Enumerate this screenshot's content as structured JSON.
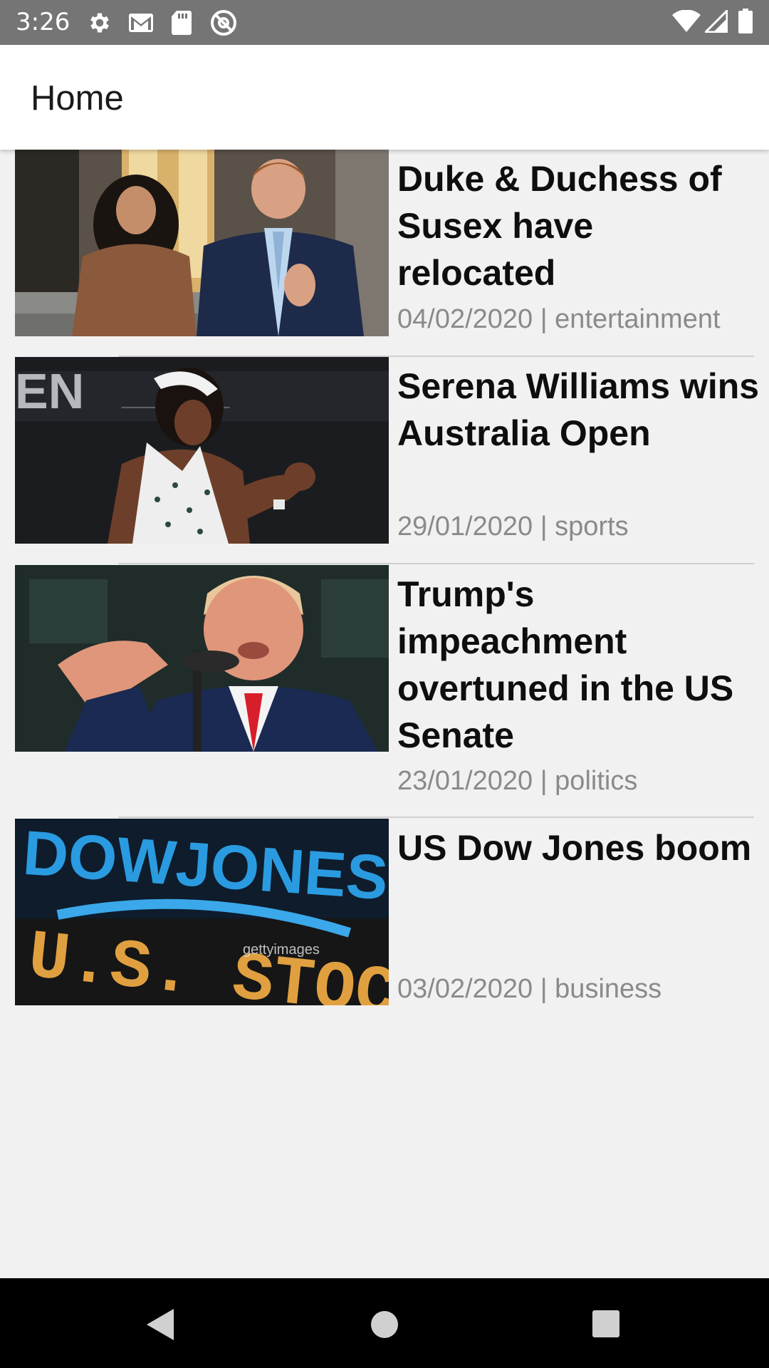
{
  "status_bar": {
    "time": "3:26",
    "left_icons": [
      "settings-gear-icon",
      "gmail-icon",
      "sd-card-icon",
      "at-sign-icon"
    ],
    "right_icons": [
      "wifi-icon",
      "cell-signal-icon",
      "battery-icon"
    ]
  },
  "app_bar": {
    "title": "Home"
  },
  "news": [
    {
      "title": "Duke & Duchess of Susex have relocated",
      "meta": "04/02/2020 | entertainment",
      "image_icon": "royal-couple-photo"
    },
    {
      "title": "Serena Williams wins Australia Open",
      "meta": "29/01/2020 | sports",
      "image_icon": "tennis-player-photo"
    },
    {
      "title": "Trump's impeachment overtuned in the US Senate",
      "meta": "23/01/2020 | politics",
      "image_icon": "politician-speech-photo"
    },
    {
      "title": "US Dow Jones boom",
      "meta": "03/02/2020 | business",
      "image_icon": "dow-jones-sign-photo"
    }
  ],
  "thumb_4_text": {
    "line1": "DOWJONES",
    "line2": "U.S. STOCKS",
    "watermark": "gettyimages"
  },
  "nav_bar": {
    "icons": [
      "back-triangle-icon",
      "home-circle-icon",
      "recents-square-icon"
    ]
  },
  "colors": {
    "status_bar": "#757575",
    "app_bar": "#ffffff",
    "background": "#f1f1f1",
    "headline": "#0e0e0e",
    "meta": "#8a8a8a",
    "nav_bar": "#000000"
  }
}
